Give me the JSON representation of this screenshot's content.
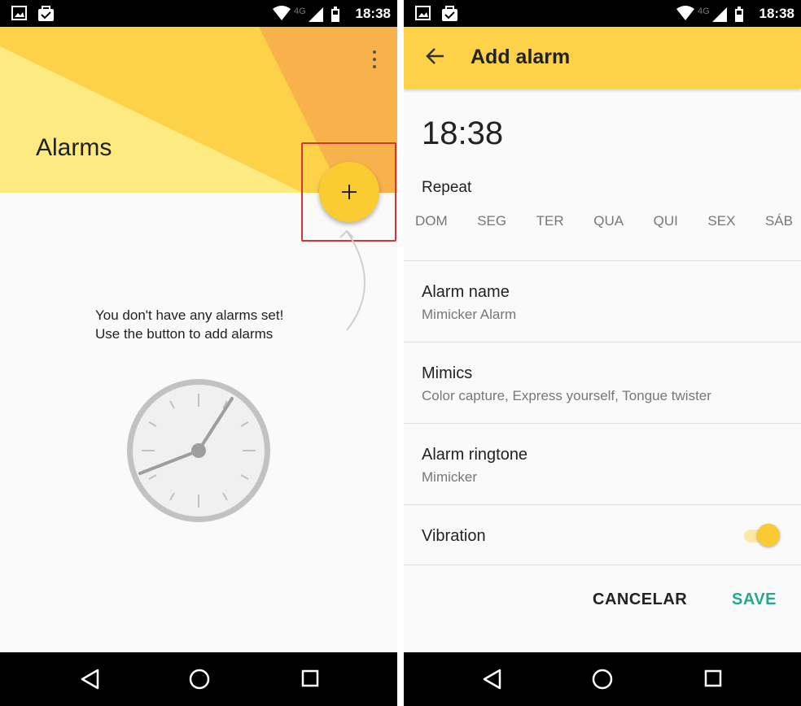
{
  "status_bar": {
    "time": "18:38",
    "network": "4G"
  },
  "alarms_screen": {
    "title": "Alarms",
    "fab_label": "+",
    "empty_line1": "You don't have any alarms set!",
    "empty_line2": "Use the button to add alarms",
    "colors": {
      "header_yellow": "#fed248",
      "light_yellow": "#fdea80",
      "orange": "#f8b24c",
      "fab": "#fbcc32",
      "highlight": "#d23535"
    }
  },
  "add_alarm_screen": {
    "title": "Add alarm",
    "time": "18:38",
    "repeat_label": "Repeat",
    "days": [
      "DOM",
      "SEG",
      "TER",
      "QUA",
      "QUI",
      "SEX",
      "SÁB"
    ],
    "alarm_name_label": "Alarm name",
    "alarm_name_value": "Mimicker Alarm",
    "mimics_label": "Mimics",
    "mimics_value": "Color capture, Express yourself, Tongue twister",
    "ringtone_label": "Alarm ringtone",
    "ringtone_value": "Mimicker",
    "vibration_label": "Vibration",
    "vibration_on": true,
    "cancel_label": "CANCELAR",
    "save_label": "SAVE",
    "colors": {
      "toolbar": "#fed248",
      "save": "#25a88c",
      "toggle": "#fbc934"
    }
  },
  "icons": [
    "image-icon",
    "shopping-bag-icon",
    "wifi-icon",
    "signal-icon",
    "battery-icon",
    "more-vert-icon",
    "add-icon",
    "arrow-back-icon",
    "back-nav-icon",
    "home-nav-icon",
    "recents-nav-icon",
    "clock-icon"
  ]
}
